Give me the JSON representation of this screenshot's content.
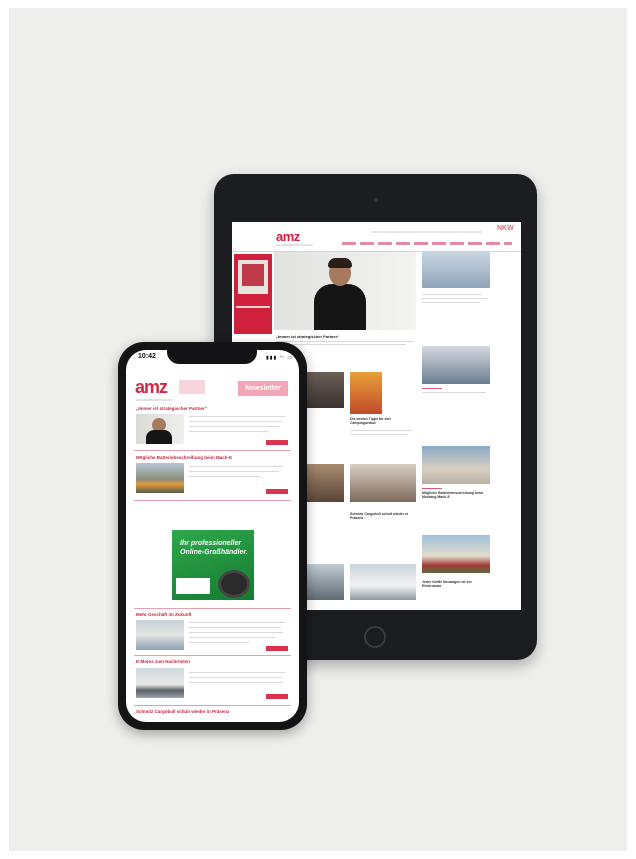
{
  "tablet": {
    "logo": "amz",
    "logo_sub": "AUTOMOBILWIRTSCHAFT",
    "nkw": "NKW",
    "hero_caption": "„Immer ist strategischer Partner“",
    "cards": [
      {
        "caption": "Die besten Tipps für den Campingurlaub"
      },
      {
        "caption": "Schmitz Cargobull schult wieder in Präsenz"
      },
      {
        "caption": "Mögliche Batteriebeschreibung beim Mustang Mach-E"
      },
      {
        "caption": "Jeder fünfte Neuwagen ist ein Elektroauto"
      }
    ]
  },
  "phone": {
    "time": "10:42",
    "status": "▮▮▮ ◠ ▭",
    "logo": "amz",
    "logo_sub": "AUTOMOBILWIRTSCHAFT",
    "newsletter_label": "Newsletter",
    "headlines": [
      "„Immer ist strategischer Partner“",
      "Mögliche Batteriebeschreibung beim Mach-E",
      "Mehr Geschäft im Zukunft",
      "E-Motos zum Nachrüsten",
      "Schmitz Cargobull schult wieder in Präsenz"
    ],
    "promo": {
      "line1": "Ihr professioneller",
      "line2": "Online-Großhändler."
    }
  },
  "colors": {
    "brand": "#d12a46",
    "background": "#eeeeec",
    "device": "#1c1d20"
  }
}
